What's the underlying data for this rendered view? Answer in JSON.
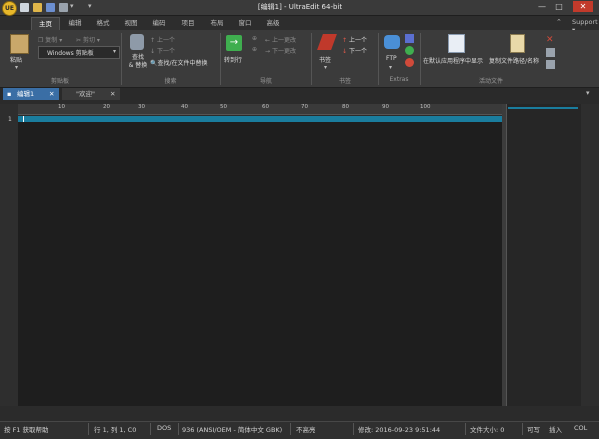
{
  "window": {
    "title": "[编辑1] - UltraEdit 64-bit",
    "logo_text": "UE",
    "controls": {
      "minimize": "—",
      "maximize": "□",
      "close": "✕"
    }
  },
  "menu_tabs": [
    "主页",
    "编辑",
    "格式",
    "视图",
    "编码",
    "项目",
    "布局",
    "窗口",
    "高级"
  ],
  "support_label": "Support",
  "ribbon": {
    "clipboard": {
      "paste": "粘贴",
      "copy": "复制",
      "cut": "剪切",
      "clipboard_select": "Windows 剪贴板",
      "group_label": "剪贴板"
    },
    "search": {
      "find_replace": "查找\n& 替换",
      "find_prev": "上一个",
      "find_next": "下一个",
      "find_in_files": "查找/在文件中替换",
      "group_label": "搜索"
    },
    "navigate": {
      "goto": "转到行",
      "prev_change": "上一更改",
      "next_change": "下一更改",
      "group_label": "导航"
    },
    "bookmarks": {
      "bookmark": "书签",
      "prev": "上一个",
      "next": "下一个",
      "group_label": "书签"
    },
    "extras": {
      "ftp": "FTP",
      "group_label": "Extras"
    },
    "active_file": {
      "open_in_default": "在默认应用程序中显示",
      "copy_path": "复制文件路径/名称",
      "group_label": "活动文件"
    }
  },
  "doc_tabs": [
    {
      "label": "编辑1",
      "active": true
    },
    {
      "label": "\"欢迎\"",
      "active": false
    }
  ],
  "ruler_ticks": [
    "10",
    "20",
    "30",
    "40",
    "50",
    "60",
    "70",
    "80",
    "90",
    "100"
  ],
  "gutter_line_number": "1",
  "status": {
    "help": "按 F1 获取帮助",
    "position": "行 1, 列 1, C0",
    "line_ending": "DOS",
    "codepage": "936  (ANSI/OEM - 简体中文 GBK)",
    "highlight": "不高亮",
    "modified": "修改:  2016-09-23 9:51:44",
    "file_size": "文件大小: 0",
    "rw": "可写",
    "insert": "插入",
    "col": "COL"
  },
  "colors": {
    "accent": "#3a6ea5",
    "current_line": "#1a7d9e",
    "editor_bg": "#1e1e1e",
    "close_red": "#c23a2b"
  }
}
